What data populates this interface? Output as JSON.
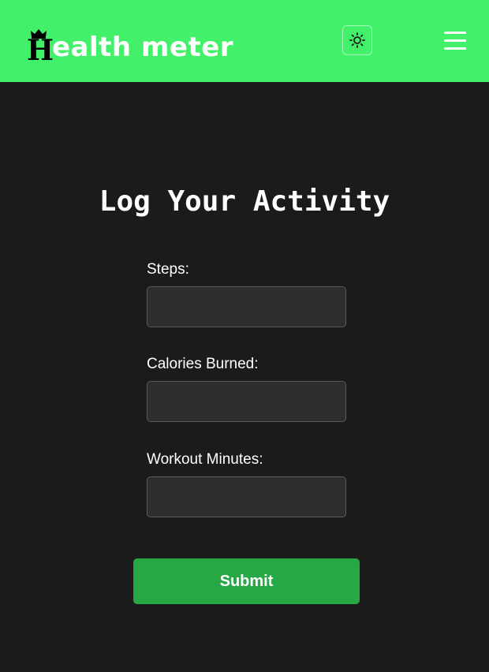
{
  "header": {
    "brand_initial": "H",
    "brand_rest": "ealth meter",
    "brand_color": "#42f06a",
    "theme_toggle_icon": "sun-icon",
    "menu_icon": "hamburger-menu-icon"
  },
  "main": {
    "title": "Log Your Activity",
    "fields": [
      {
        "label": "Steps:",
        "value": "",
        "placeholder": ""
      },
      {
        "label": "Calories Burned:",
        "value": "",
        "placeholder": ""
      },
      {
        "label": "Workout Minutes:",
        "value": "",
        "placeholder": ""
      }
    ],
    "submit_label": "Submit",
    "submit_color": "#28a745"
  },
  "theme": {
    "background": "#1b1b1c",
    "input_background": "#2d2d2d"
  }
}
